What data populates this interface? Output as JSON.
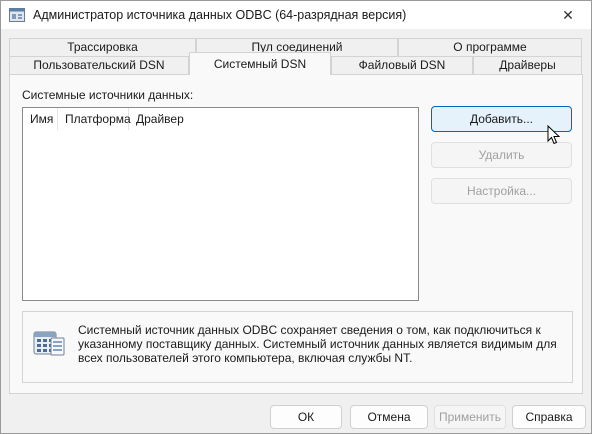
{
  "window": {
    "title": "Администратор источника данных ODBC (64-разрядная версия)",
    "close_glyph": "✕"
  },
  "tabs": {
    "row1": [
      {
        "label": "Трассировка"
      },
      {
        "label": "Пул соединений"
      },
      {
        "label": "О программе"
      }
    ],
    "row2": [
      {
        "label": "Пользовательский DSN"
      },
      {
        "label": "Системный DSN",
        "active": true
      },
      {
        "label": "Файловый DSN"
      },
      {
        "label": "Драйверы"
      }
    ]
  },
  "panel": {
    "section_label": "Системные источники данных:",
    "columns": [
      "Имя",
      "Платформа",
      "Драйвер"
    ],
    "rows": []
  },
  "side_buttons": {
    "add": "Добавить...",
    "remove": "Удалить",
    "configure": "Настройка..."
  },
  "info": {
    "text": "Системный источник данных ODBC сохраняет сведения о том, как подключиться к указанному поставщику данных.  Системный источник данных является видимым для всех пользователей этого компьютера, включая службы NT."
  },
  "footer": {
    "ok": "ОК",
    "cancel": "Отмена",
    "apply": "Применить",
    "help": "Справка"
  },
  "colors": {
    "accent": "#0067c0",
    "window_bg": "#f0f0f0",
    "panel_bg": "#f9f9f9"
  }
}
